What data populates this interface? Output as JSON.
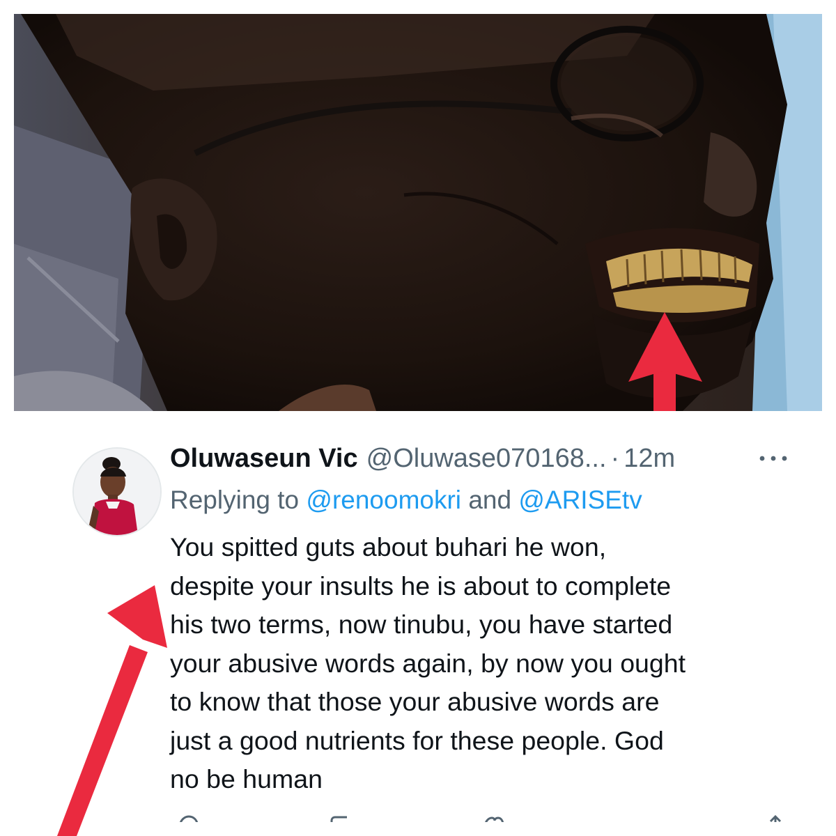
{
  "tweet": {
    "display_name": "Oluwaseun Vic",
    "handle": "@Oluwase070168...",
    "separator": "·",
    "time": "12m",
    "replying_prefix": "Replying to",
    "mention_1": "@renoomokri",
    "mention_joiner": "and",
    "mention_2": "@ARISEtv",
    "body_lines": [
      "You spitted guts about buhari he won,",
      "despite your insults he is about to complete",
      "his two terms, now tinubu, you have started",
      "your abusive words again, by now you ought",
      "to know that those your abusive words are",
      "just a good nutrients for these people. God",
      "no be human"
    ]
  },
  "colors": {
    "text_primary": "#0f1419",
    "text_secondary": "#536471",
    "link": "#1d9bf0",
    "arrow": "#ea2a3f"
  },
  "icons": {
    "more": "more-horizontal-icon",
    "reply": "reply-icon",
    "retweet": "retweet-icon",
    "like": "like-icon",
    "share": "share-icon"
  }
}
